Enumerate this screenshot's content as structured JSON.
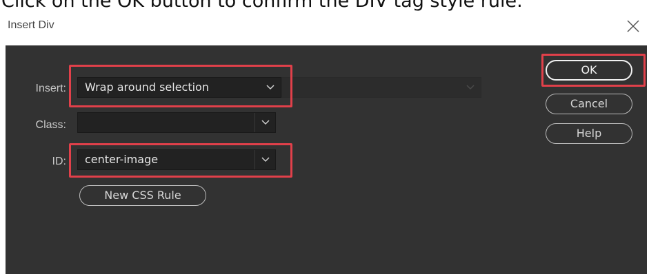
{
  "instruction": "Click on the OK button to confirm the DIV tag style rule.",
  "dialog": {
    "title": "Insert Div",
    "close_icon": "close-icon",
    "fields": {
      "insert": {
        "label": "Insert:",
        "value": "Wrap around selection"
      },
      "insert_target": {
        "value": ""
      },
      "class": {
        "label": "Class:",
        "value": ""
      },
      "id": {
        "label": "ID:",
        "value": "center-image"
      }
    },
    "buttons": {
      "new_css_rule": "New CSS Rule",
      "ok": "OK",
      "cancel": "Cancel",
      "help": "Help"
    }
  },
  "colors": {
    "dialog_bg": "#323232",
    "field_bg": "#222222",
    "highlight": "#e1404a",
    "label_text": "#c8c8c8"
  }
}
